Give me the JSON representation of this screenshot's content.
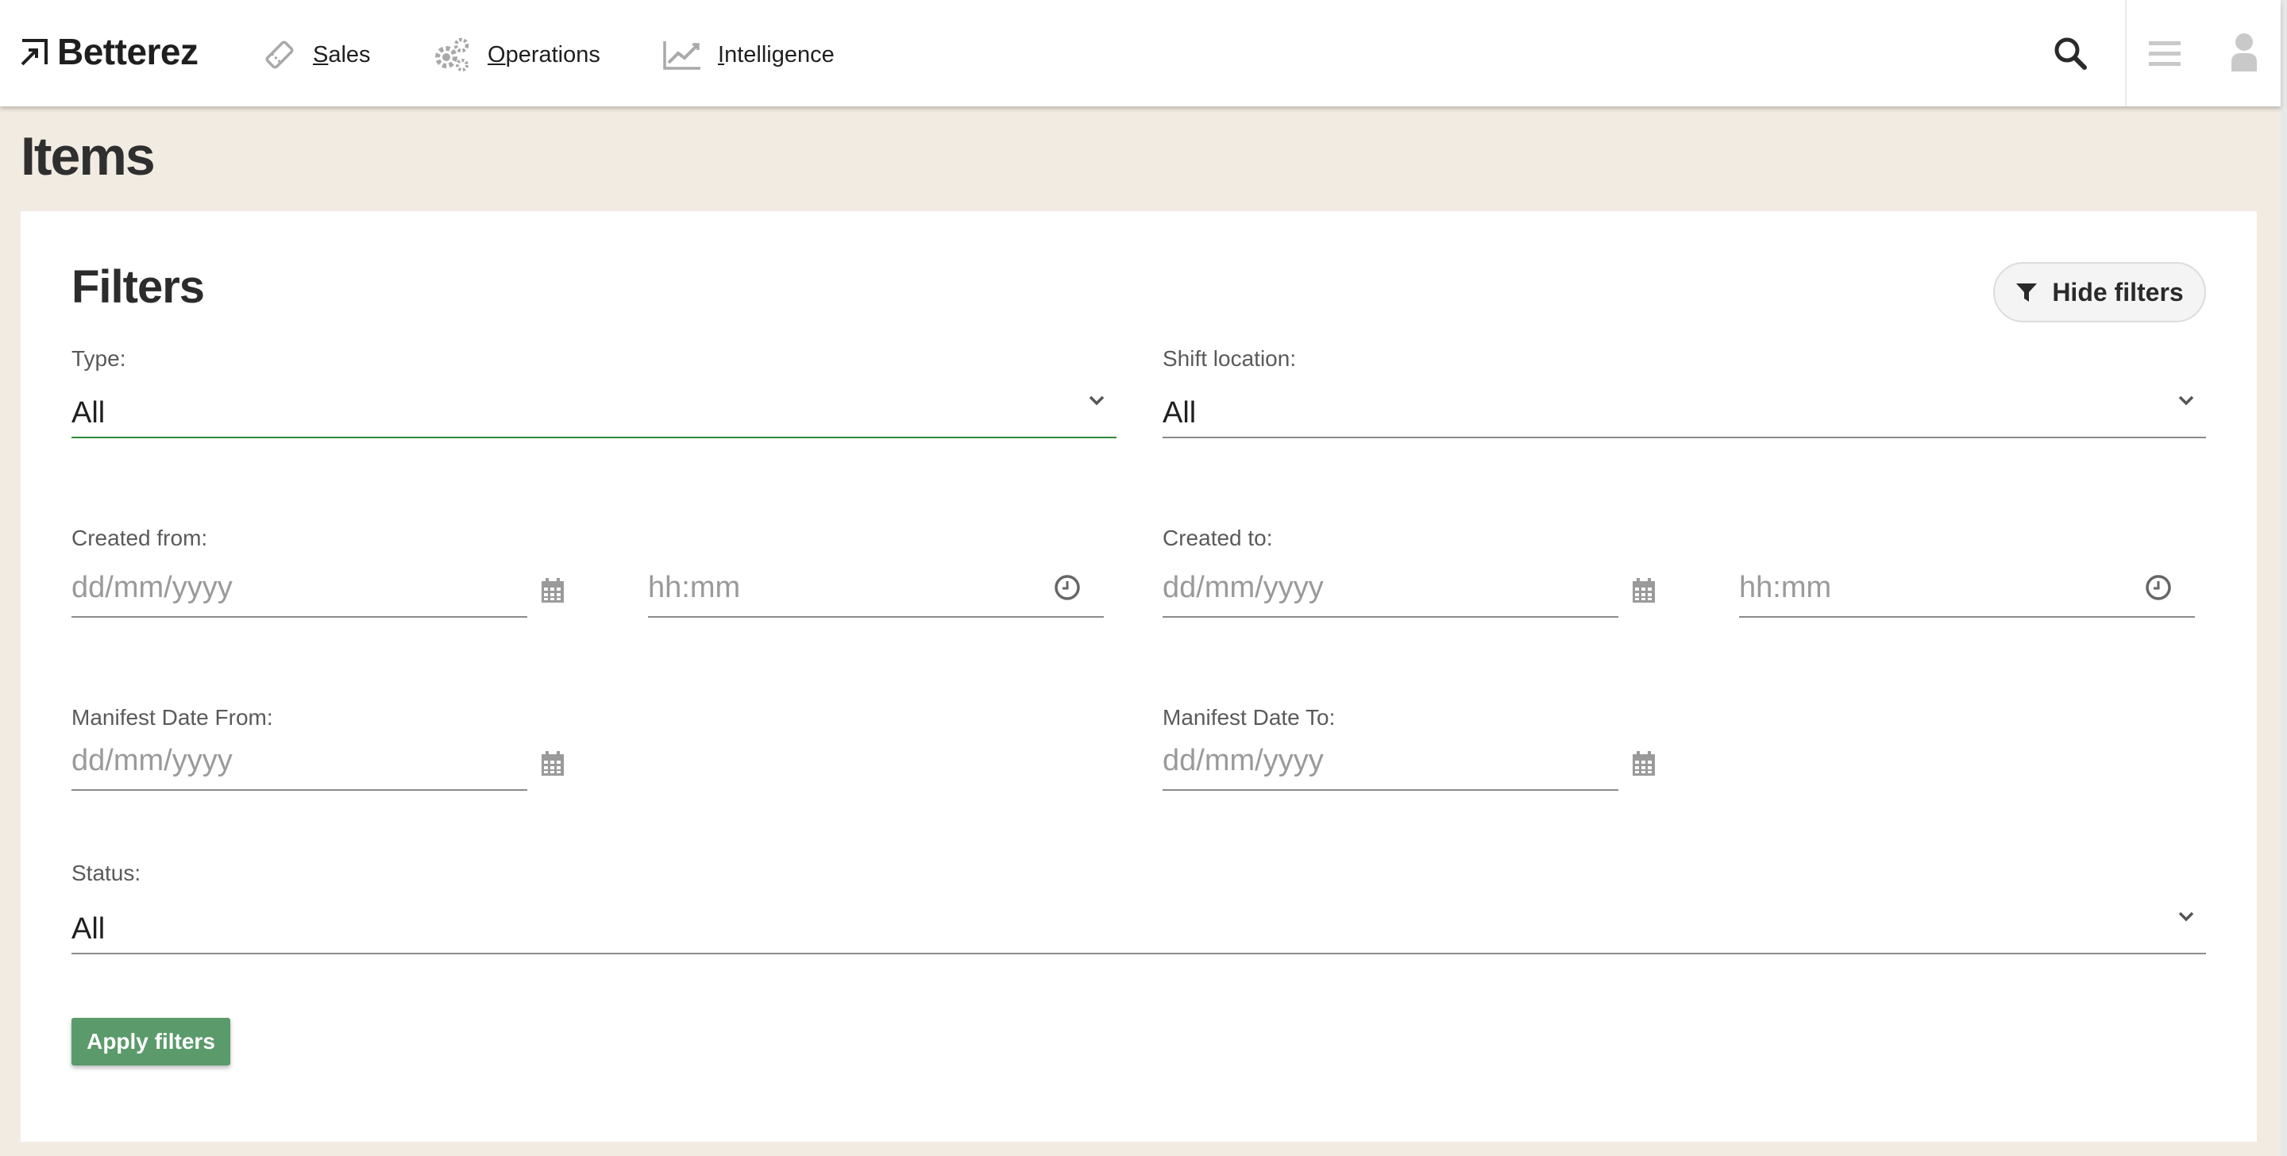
{
  "app": {
    "brand": "Betterez"
  },
  "nav": {
    "items": [
      {
        "label": "Sales",
        "icon": "ticket-icon"
      },
      {
        "label": "Operations",
        "icon": "gears-icon"
      },
      {
        "label": "Intelligence",
        "icon": "chart-line-icon"
      }
    ]
  },
  "header_actions": {
    "search_icon": "search-icon",
    "menu_icon": "hamburger-menu-icon",
    "user_icon": "user-icon"
  },
  "page": {
    "title": "Items"
  },
  "filters": {
    "title": "Filters",
    "hide_button": "Hide filters",
    "type": {
      "label": "Type:",
      "value": "All"
    },
    "shift_location": {
      "label": "Shift location:",
      "value": "All"
    },
    "created_from": {
      "label": "Created from:",
      "date_placeholder": "dd/mm/yyyy",
      "time_placeholder": "hh:mm"
    },
    "created_to": {
      "label": "Created to:",
      "date_placeholder": "dd/mm/yyyy",
      "time_placeholder": "hh:mm"
    },
    "manifest_from": {
      "label": "Manifest Date From:",
      "date_placeholder": "dd/mm/yyyy"
    },
    "manifest_to": {
      "label": "Manifest Date To:",
      "date_placeholder": "dd/mm/yyyy"
    },
    "status": {
      "label": "Status:",
      "value": "All"
    },
    "apply_button": "Apply filters"
  },
  "colors": {
    "page_bg": "#f2ebe2",
    "apply_green": "#5b9a6b",
    "active_underline": "#2e8b3a"
  }
}
